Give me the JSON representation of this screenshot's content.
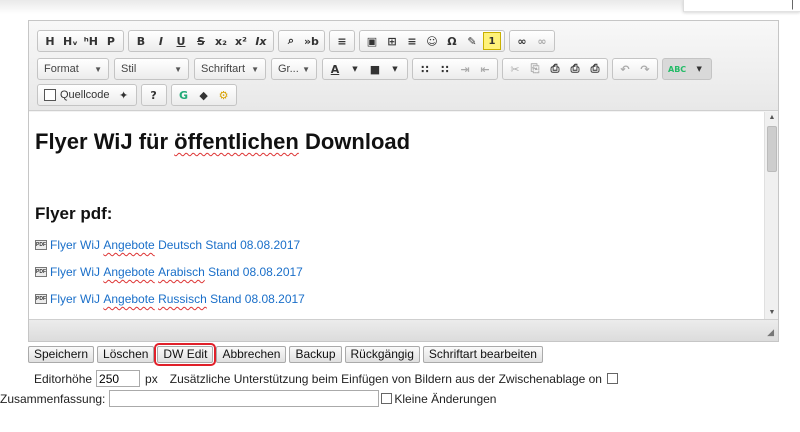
{
  "toolbar": {
    "row1": {
      "headings": [
        "H",
        "Hᵥ",
        "ʰH",
        "P"
      ],
      "text_format": [
        "B",
        "I",
        "U",
        "S",
        "x₂",
        "x²",
        "Ix"
      ],
      "find": [
        "⌕",
        "»b"
      ],
      "block": [
        "≡"
      ],
      "insert": [
        "▣",
        "⊞",
        "≡",
        "☺",
        "Ω",
        "✎",
        "1"
      ],
      "links": [
        "∞",
        "∞"
      ]
    },
    "row2": {
      "combos": [
        "Format",
        "Stil",
        "Schriftart",
        "Gr..."
      ],
      "colors": [
        "A",
        "■"
      ],
      "lists": [
        "∷",
        "∷",
        "⇥",
        "⇤"
      ],
      "clipboard": [
        "✂",
        "⎘",
        "⎙",
        "⎙",
        "⎙"
      ],
      "history": [
        "↶",
        "↷"
      ],
      "spellcheck": "ABC"
    },
    "row3": {
      "source_label": "Quellcode",
      "maximize": "✦",
      "help": "?",
      "extras": [
        "G",
        "◆",
        "⚙"
      ]
    }
  },
  "content": {
    "title_prefix": "Flyer WiJ für ",
    "title_spell": "öffentlichen",
    "title_suffix": " Download",
    "subheading": "Flyer pdf:",
    "links": [
      {
        "pre": "Flyer WiJ ",
        "spell": "Angebote",
        "post": " Deutsch Stand 08.08.2017"
      },
      {
        "pre": "Flyer WiJ ",
        "spell": "Angebote",
        "post": " ",
        "spell2": "Arabisch",
        "post2": " Stand 08.08.2017"
      },
      {
        "pre": "Flyer WiJ ",
        "spell": "Angebote",
        "post": " ",
        "spell2": "Russisch",
        "post2": " Stand 08.08.2017"
      }
    ],
    "pdf_badge": "PDF"
  },
  "actions": {
    "save": "Speichern",
    "delete": "Löschen",
    "dw_edit": "DW Edit",
    "cancel": "Abbrechen",
    "backup": "Backup",
    "undo": "Rückgängig",
    "edit_font": "Schriftart bearbeiten"
  },
  "options": {
    "editor_height_label": "Editorhöhe",
    "editor_height_value": "250",
    "unit": "px",
    "paste_support_label": "Zusätzliche Unterstützung beim Einfügen von Bildern aus der Zwischenablage on",
    "summary_label": "Zusammenfassung:",
    "minor_changes_label": "Kleine Änderungen"
  },
  "colors": {
    "link": "#1a6fc9",
    "highlight": "#e0202a"
  }
}
